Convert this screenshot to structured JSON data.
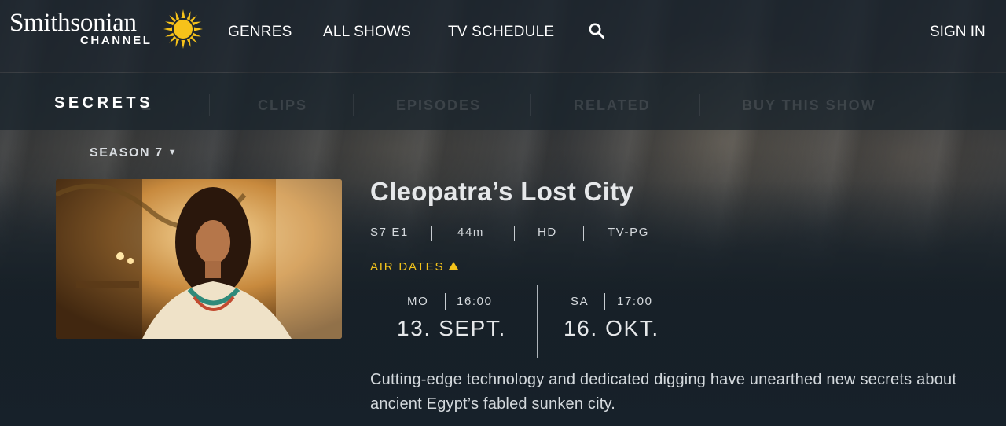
{
  "brand": {
    "word": "Smithsonian",
    "channel": "CHANNEL",
    "sun_color": "#f6c21a"
  },
  "nav": {
    "genres": "GENRES",
    "all_shows": "ALL SHOWS",
    "tv_schedule": "TV SCHEDULE",
    "search_icon": "search-icon",
    "sign_in": "SIGN IN"
  },
  "show": {
    "title": "SECRETS",
    "tabs": [
      {
        "label": "CLIPS"
      },
      {
        "label": "EPISODES"
      },
      {
        "label": "RELATED"
      },
      {
        "label": "BUY THIS SHOW"
      }
    ],
    "ghost_tab_suffix": "E"
  },
  "season": {
    "label": "SEASON 7"
  },
  "episode": {
    "title": "Cleopatra’s Lost City",
    "meta": {
      "number": "S7 E1",
      "duration": "44m",
      "quality": "HD",
      "rating": "TV-PG"
    },
    "air_dates_label": "AIR DATES",
    "air_dates": [
      {
        "day": "MO",
        "time": "16:00",
        "date": "13. SEPT."
      },
      {
        "day": "SA",
        "time": "17:00",
        "date": "16. OKT."
      }
    ],
    "description": "Cutting-edge technology and dedicated digging have unearthed new secrets about ancient Egypt’s fabled sunken city."
  },
  "colors": {
    "accent_yellow": "#f2c21b",
    "nav_bg": "#1c242c"
  }
}
